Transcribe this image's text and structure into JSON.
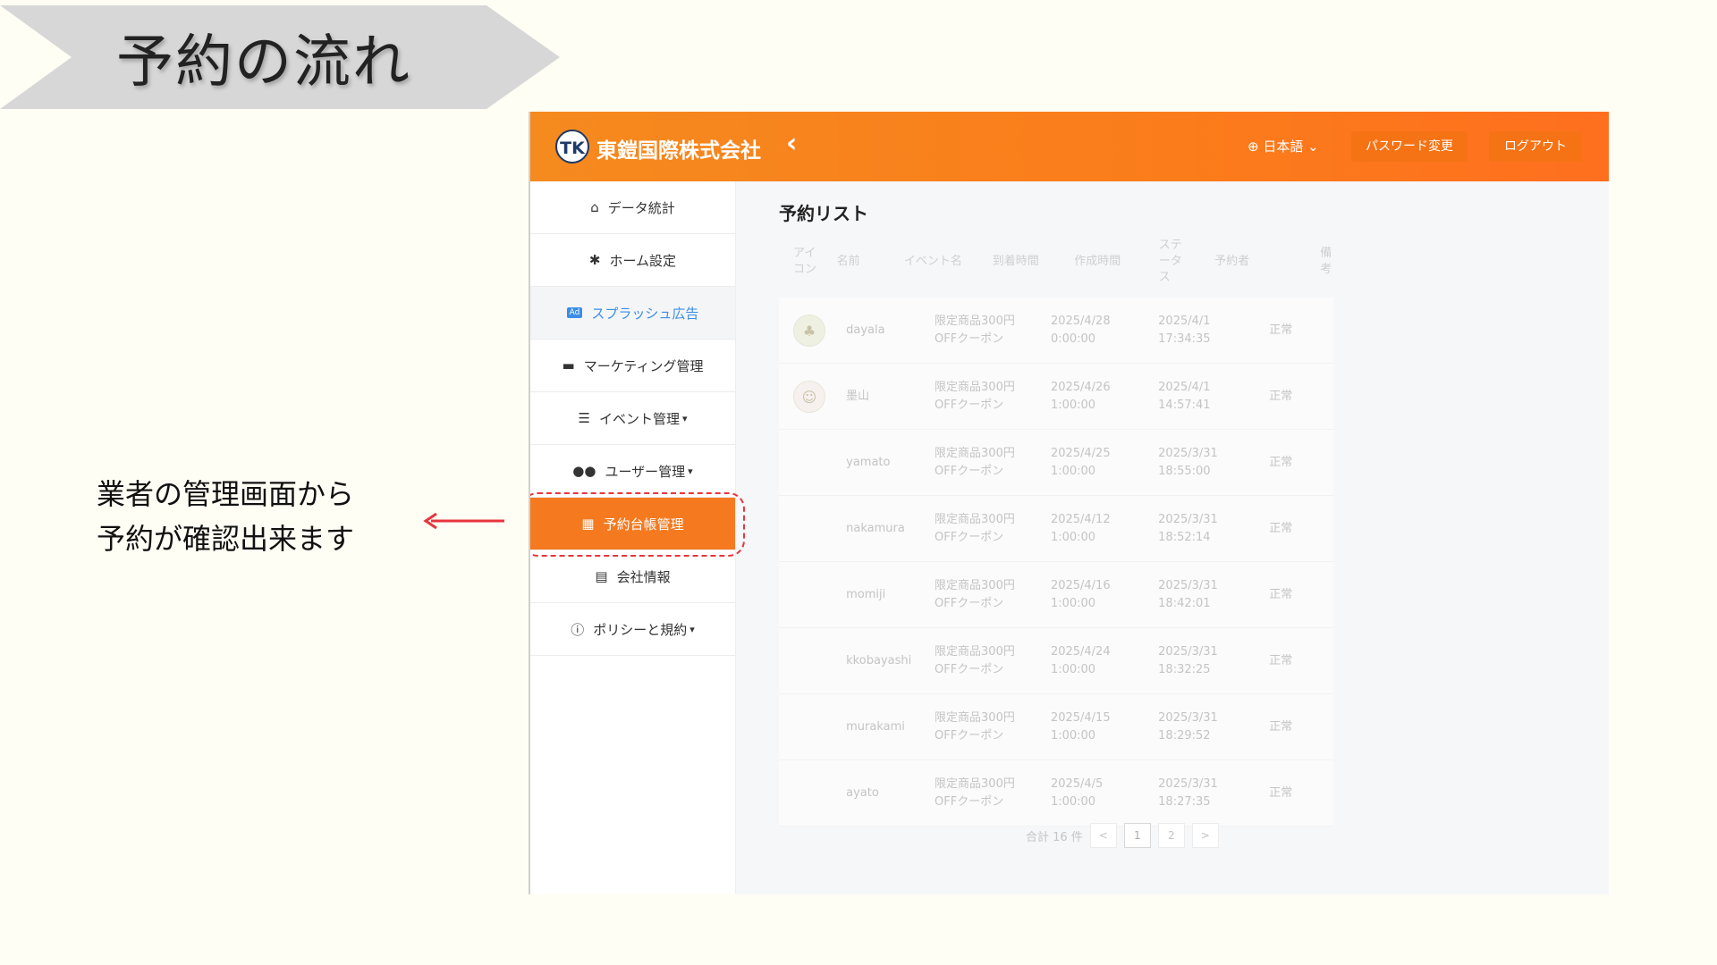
{
  "slide": {
    "title": "予約の流れ",
    "annotation_line1": "業者の管理画面から",
    "annotation_line2": "予約が確認出来ます"
  },
  "header": {
    "logo_text": "TK",
    "brand": "東鎧国際株式会社",
    "collapse_icon": "chevron-left-icon",
    "language": "日本語",
    "password_button": "パスワード変更",
    "logout_button": "ログアウト"
  },
  "sidebar": {
    "items": [
      {
        "label": "データ統計",
        "icon": "home-icon"
      },
      {
        "label": "ホーム設定",
        "icon": "gear-icon"
      },
      {
        "label": "スプラッシュ広告",
        "icon": "ad-icon"
      },
      {
        "label": "マーケティング管理",
        "icon": "store-icon"
      },
      {
        "label": "イベント管理",
        "icon": "list-check-icon"
      },
      {
        "label": "ユーザー管理",
        "icon": "users-icon"
      },
      {
        "label": "予約台帳管理",
        "icon": "calendar-icon"
      },
      {
        "label": "会社情報",
        "icon": "document-icon"
      },
      {
        "label": "ポリシーと規約",
        "icon": "info-icon"
      }
    ]
  },
  "main": {
    "title": "予約リスト",
    "columns": {
      "icon": "アイコン",
      "name": "名前",
      "event": "イベント名",
      "arrival": "到着時間",
      "created": "作成時間",
      "status": "ステータス",
      "user": "予約者",
      "note": "備考"
    },
    "rows": [
      {
        "name": "dayala",
        "event1": "限定商品300円",
        "event2": "OFFクーポン",
        "arr1": "2025/4/28",
        "arr2": "0:00:00",
        "cre1": "2025/4/1",
        "cre2": "17:34:35",
        "status": "正常"
      },
      {
        "name": "墨山",
        "event1": "限定商品300円",
        "event2": "OFFクーポン",
        "arr1": "2025/4/26",
        "arr2": "1:00:00",
        "cre1": "2025/4/1",
        "cre2": "14:57:41",
        "status": "正常"
      },
      {
        "name": "yamato",
        "event1": "限定商品300円",
        "event2": "OFFクーポン",
        "arr1": "2025/4/25",
        "arr2": "1:00:00",
        "cre1": "2025/3/31",
        "cre2": "18:55:00",
        "status": "正常"
      },
      {
        "name": "nakamura",
        "event1": "限定商品300円",
        "event2": "OFFクーポン",
        "arr1": "2025/4/12",
        "arr2": "1:00:00",
        "cre1": "2025/3/31",
        "cre2": "18:52:14",
        "status": "正常"
      },
      {
        "name": "momiji",
        "event1": "限定商品300円",
        "event2": "OFFクーポン",
        "arr1": "2025/4/16",
        "arr2": "1:00:00",
        "cre1": "2025/3/31",
        "cre2": "18:42:01",
        "status": "正常"
      },
      {
        "name": "kkobayashi",
        "event1": "限定商品300円",
        "event2": "OFFクーポン",
        "arr1": "2025/4/24",
        "arr2": "1:00:00",
        "cre1": "2025/3/31",
        "cre2": "18:32:25",
        "status": "正常"
      },
      {
        "name": "murakami",
        "event1": "限定商品300円",
        "event2": "OFFクーポン",
        "arr1": "2025/4/15",
        "arr2": "1:00:00",
        "cre1": "2025/3/31",
        "cre2": "18:29:52",
        "status": "正常"
      },
      {
        "name": "ayato",
        "event1": "限定商品300円",
        "event2": "OFFクーポン",
        "arr1": "2025/4/5",
        "arr2": "1:00:00",
        "cre1": "2025/3/31",
        "cre2": "18:27:35",
        "status": "正常"
      }
    ],
    "pagination": {
      "total": "合計 16 件",
      "prev": "<",
      "page1": "1",
      "page2": "2",
      "next": ">"
    }
  }
}
